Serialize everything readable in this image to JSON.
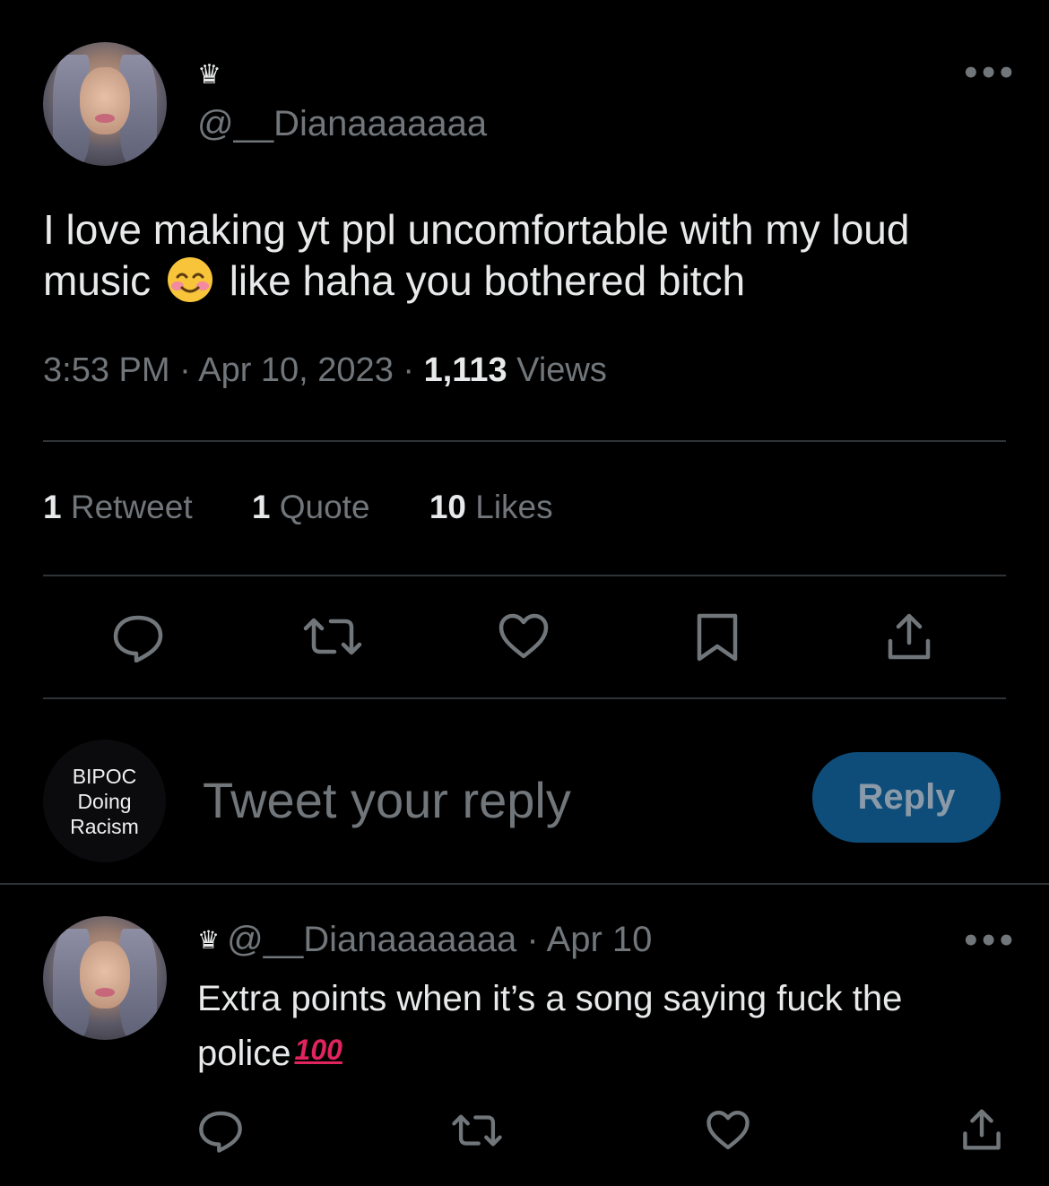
{
  "tweet": {
    "display_name_icon": "crown-icon",
    "handle": "@__Dianaaaaaaa",
    "text_before_emoji": "I love making yt ppl uncomfortable with my loud music",
    "emoji": "smiling-face-with-smiling-eyes",
    "text_after_emoji": "like haha you bothered bitch",
    "time": "3:53 PM",
    "date": "Apr 10, 2023",
    "views_count": "1,113",
    "views_label": "Views",
    "separator": "·"
  },
  "stats": {
    "retweets_count": "1",
    "retweets_label": "Retweet",
    "quotes_count": "1",
    "quotes_label": "Quote",
    "likes_count": "10",
    "likes_label": "Likes"
  },
  "actions": [
    "reply-icon",
    "retweet-icon",
    "like-icon",
    "bookmark-icon",
    "share-icon"
  ],
  "composer": {
    "avatar_line1": "BIPOC",
    "avatar_line2": "Doing",
    "avatar_line3": "Racism",
    "placeholder": "Tweet your reply",
    "button_label": "Reply"
  },
  "reply": {
    "handle": "@__Dianaaaaaaa",
    "date": "Apr 10",
    "separator": "·",
    "text": "Extra points when it’s a song saying fuck the police",
    "emoji": "100-icon",
    "emoji_text": "100"
  },
  "colors": {
    "background": "#000000",
    "text": "#e7e9ea",
    "secondary": "#71767b",
    "divider": "#2f3336",
    "reply_button": "#0e4d7a",
    "hundred": "#e0245e"
  }
}
